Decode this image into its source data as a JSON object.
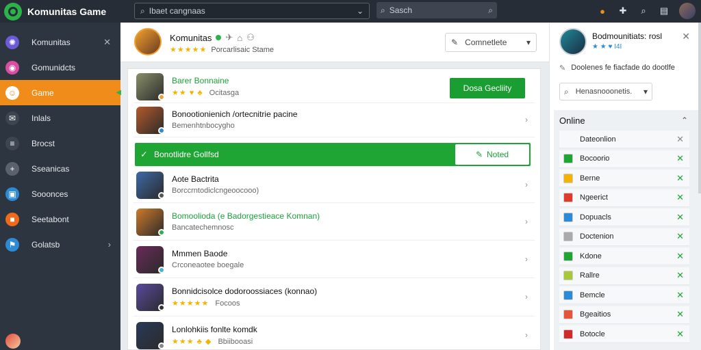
{
  "app": {
    "title": "Komunitas Game"
  },
  "topbar": {
    "select_value": "Ibaet cangnaas",
    "search_placeholder": "Sasch",
    "icons": [
      "notification-icon",
      "puzzle-icon",
      "search-icon",
      "menu-icon",
      "avatar"
    ]
  },
  "sidebar": {
    "items": [
      {
        "label": "Komunitas",
        "icon": "community-icon",
        "right": "✕",
        "color": "#6b5bd6"
      },
      {
        "label": "Gomunidcts",
        "icon": "games-icon",
        "right": "",
        "color": "#d94ea0"
      },
      {
        "label": "Game",
        "icon": "user-icon",
        "right": "◀",
        "active": true,
        "color": "#ffffff"
      },
      {
        "label": "Inlals",
        "icon": "mail-icon",
        "right": "",
        "color": "#3d4650"
      },
      {
        "label": "Brocst",
        "icon": "list-icon",
        "right": "",
        "color": "#3d4650"
      },
      {
        "label": "Sseanicas",
        "icon": "plus-icon",
        "right": "",
        "color": "#5a636d"
      },
      {
        "label": "Sooonces",
        "icon": "folder-icon",
        "right": "",
        "color": "#2d8bd6"
      },
      {
        "label": "Seetabont",
        "icon": "box-icon",
        "right": "",
        "color": "#ef6a1a"
      },
      {
        "label": "Golatsb",
        "icon": "flag-icon",
        "right": "›",
        "color": "#2d8bd6"
      }
    ]
  },
  "header": {
    "title": "Komunitas",
    "subtitle": "Porcarlisaic Stame",
    "rating": "★★★★★",
    "select_value": "Comnetlete"
  },
  "list": {
    "rows": [
      {
        "title": "Barer Bonnaine",
        "sub": "Ocitasga",
        "rating": "★★ ♥ ♣",
        "green": true,
        "button": "Dosa Gecliity",
        "avatar": "#8a8f6a",
        "badge": "#f0a030"
      },
      {
        "title": "Bonootionienich /ortecnitrie pacine",
        "sub": "Bemenhtnbocygho",
        "rating": "",
        "avatar": "#b55a2a",
        "badge": "#2d8bd6"
      },
      {
        "title": "Aote Bactrita",
        "sub": "Borccrntodiclcngeoocooo)",
        "rating": "",
        "avatar": "#3d6aa8",
        "badge": "#555"
      },
      {
        "title": "Bomoolioda (e Badorgestieace Komnan)",
        "sub": "Bancatechemnosc",
        "rating": "",
        "green": true,
        "avatar": "#d07a2a",
        "badge": "#2bb34a"
      },
      {
        "title": "Mmmen Baode",
        "sub": "Crconeaotee boegale",
        "rating": "",
        "avatar": "#6a2a5a",
        "badge": "#48b0d8"
      },
      {
        "title": "Bonnidcisolce dodoroossiaces (konnao)",
        "sub": "Focoos",
        "rating": "★★★★★",
        "avatar": "#5a4aa0",
        "badge": "#333"
      },
      {
        "title": "Lonlohkiis fonlte komdk",
        "sub": "Bbiibooasi",
        "rating": "★★★ ♣ ◆",
        "avatar": "#2a3a5a",
        "badge": "#888"
      }
    ],
    "banner": {
      "text": "Bonotlidre Gollfsd",
      "button": "Noted"
    }
  },
  "right_panel": {
    "title": "Bodmounitiats: rosl",
    "sub": "★ ★ ♥ I4I",
    "note": "Doolenes fe fiacfade do dootlfe",
    "select_value": "Henasnooonetis.",
    "online": {
      "heading": "Online",
      "items": [
        {
          "label": "Dateonlion",
          "color": "#f6f8f9",
          "x_grey": true
        },
        {
          "label": "Bocoorio",
          "color": "#1fa534"
        },
        {
          "label": "Berne",
          "color": "#f5b301"
        },
        {
          "label": "Ngeerict",
          "color": "#e03a2a"
        },
        {
          "label": "Dopuacls",
          "color": "#2d8bd6"
        },
        {
          "label": "Doctenion",
          "color": "#aaa"
        },
        {
          "label": "Kdone",
          "color": "#1fa534"
        },
        {
          "label": "Rallre",
          "color": "#a8c83a"
        },
        {
          "label": "Bemcle",
          "color": "#2d8bd6"
        },
        {
          "label": "Bgeaitios",
          "color": "#e5553a"
        },
        {
          "label": "Botocle",
          "color": "#d02a2a"
        }
      ]
    }
  }
}
